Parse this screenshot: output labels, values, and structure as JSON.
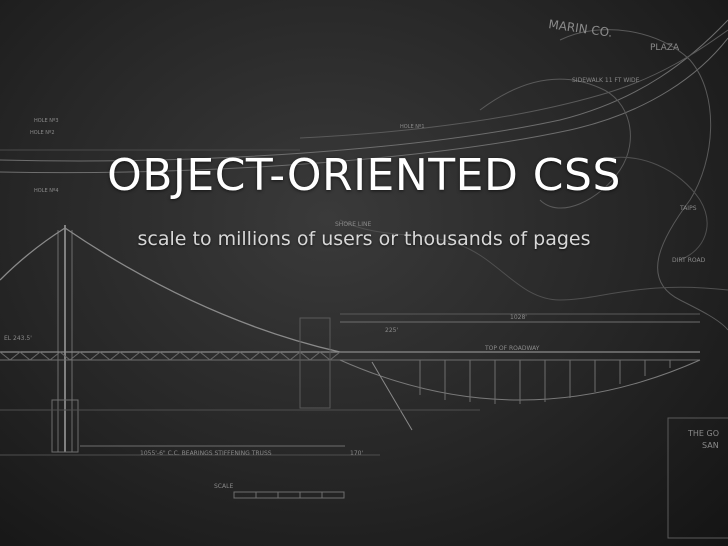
{
  "slide": {
    "title": "OBJECT-ORIENTED CSS",
    "subtitle": "scale to millions of users or thousands of pages"
  },
  "blueprint": {
    "labels": {
      "marin": "MARIN CO.",
      "plaza": "PLAZA",
      "sidewalk": "SIDEWALK 11 FT WIDE",
      "hole1": "HOLE Nº3",
      "hole2": "HOLE Nº2",
      "hole3": "HOLE Nº1",
      "hole4": "HOLE Nº4",
      "shore": "SHORE LINE",
      "tower_el": "EL 243.5'",
      "truss": "1055'-6\" C.C. BEARINGS STIFFENING TRUSS",
      "dim_170": "170'",
      "dim_1028": "1028'",
      "dim_225": "225'",
      "top_of_roadway": "TOP OF ROADWAY",
      "scale": "SCALE",
      "corner_a": "THE GO",
      "corner_b": "SAN",
      "taipa": "TAIPS",
      "dirt_road": "DIRT ROAD"
    },
    "colors": {
      "line": "#7a7a7a",
      "line_faint": "#5a5a5a"
    }
  }
}
